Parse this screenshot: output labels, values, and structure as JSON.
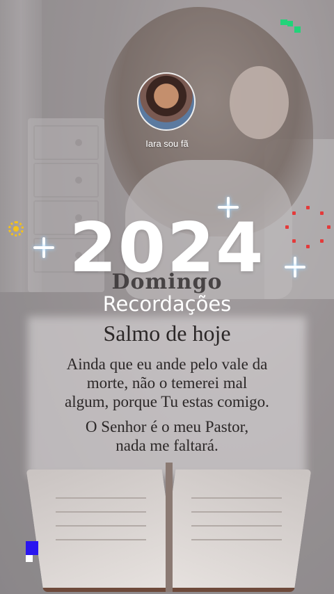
{
  "profile": {
    "name": "Iara sou fã"
  },
  "headline": {
    "overlay_day": "Domingo",
    "year": "2024",
    "subtitle": "Recordações"
  },
  "content": {
    "title": "Salmo de hoje",
    "verse_lines": [
      "Ainda que eu ande pelo vale da",
      "morte, não o temerei mal",
      "algum, porque Tu estas comigo."
    ],
    "closing_lines": [
      "O Senhor é o meu Pastor,",
      "nada me faltará."
    ]
  },
  "colors": {
    "accent_green": "#22d37a",
    "accent_blue": "#2a16f0",
    "sun_yellow": "#f4c21a",
    "dots_red": "#e43a3a"
  },
  "icons": [
    "sparkle-icon",
    "sun-icon",
    "red-dots-ring-icon",
    "green-pixel-icon",
    "blue-pixel-icon"
  ]
}
